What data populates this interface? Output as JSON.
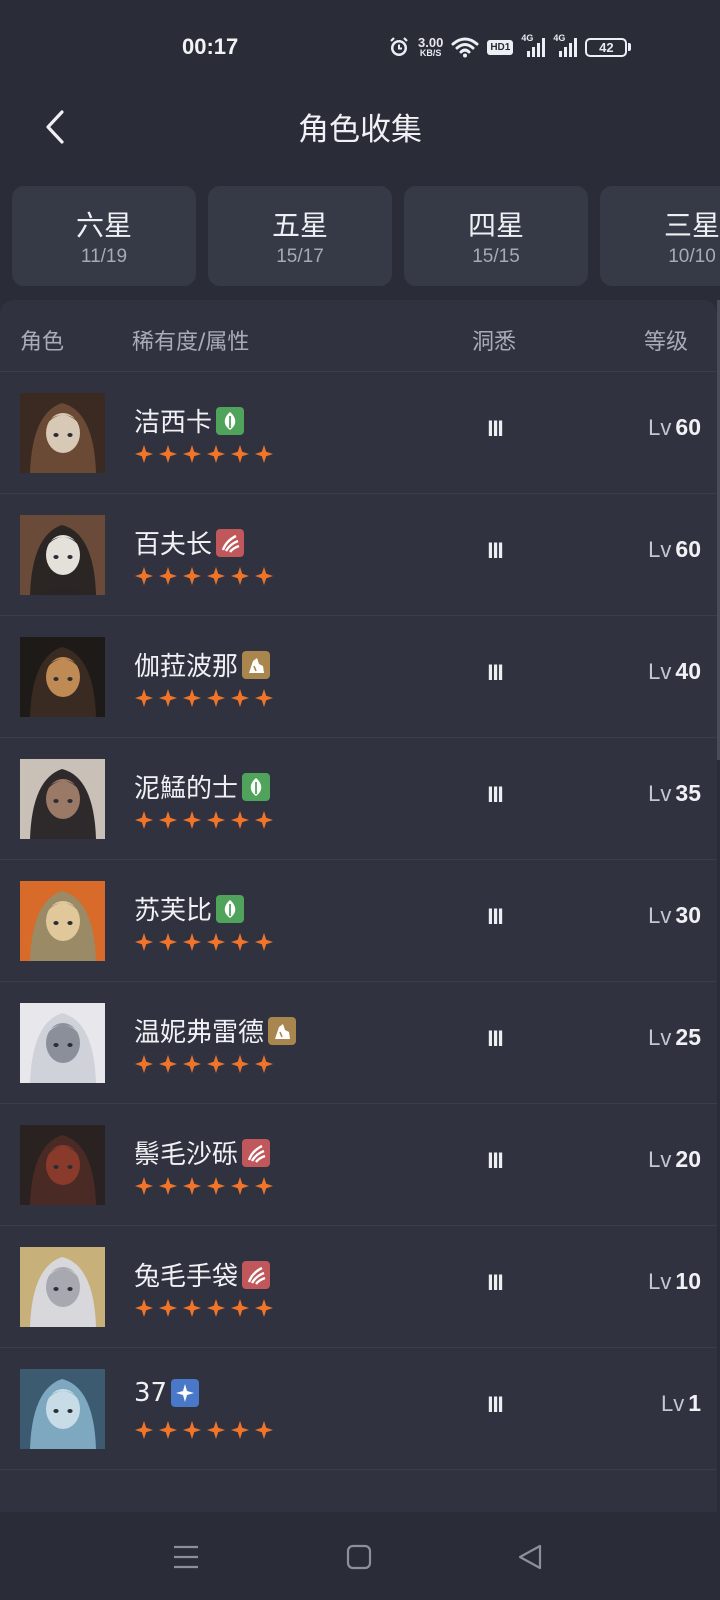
{
  "status_bar": {
    "time": "00:17",
    "net_speed_value": "3.00",
    "net_speed_unit": "KB/S",
    "hd_label": "HD1",
    "signal1_label": "4G",
    "signal2_label": "4G",
    "battery": "42"
  },
  "header": {
    "title": "角色收集"
  },
  "tabs": [
    {
      "label": "六星",
      "count": "11/19"
    },
    {
      "label": "五星",
      "count": "15/17"
    },
    {
      "label": "四星",
      "count": "15/15"
    },
    {
      "label": "三星",
      "count": "10/10"
    }
  ],
  "table": {
    "columns": {
      "role": "角色",
      "rarity": "稀有度/属性",
      "insight": "洞悉",
      "level": "等级"
    },
    "level_prefix": "Lv",
    "rows": [
      {
        "name": "洁西卡",
        "attribute": "plant",
        "insight": "III",
        "level": "60"
      },
      {
        "name": "百夫长",
        "attribute": "beast",
        "insight": "III",
        "level": "60"
      },
      {
        "name": "伽菈波那",
        "attribute": "mineral",
        "insight": "III",
        "level": "40"
      },
      {
        "name": "泥鯭的士",
        "attribute": "plant",
        "insight": "III",
        "level": "35"
      },
      {
        "name": "苏芙比",
        "attribute": "plant",
        "insight": "III",
        "level": "30"
      },
      {
        "name": "温妮弗雷德",
        "attribute": "mineral",
        "insight": "III",
        "level": "25"
      },
      {
        "name": "鬃毛沙砾",
        "attribute": "beast",
        "insight": "III",
        "level": "20"
      },
      {
        "name": "兔毛手袋",
        "attribute": "beast",
        "insight": "III",
        "level": "10"
      },
      {
        "name": "37",
        "attribute": "star",
        "insight": "III",
        "level": "1"
      }
    ]
  },
  "colors": {
    "background": "#2a2d38",
    "panel": "#30333f",
    "star": "#f0742a",
    "plant": "#4fa35a",
    "beast": "#c0575a",
    "mineral": "#a9864e",
    "star_attr": "#4a78c8"
  },
  "icons": {
    "back": "chevron-left-icon",
    "plant": "leaf-icon",
    "beast": "claw-icon",
    "mineral": "rock-icon",
    "star": "four-point-star-icon",
    "nav_menu": "menu-icon",
    "nav_home": "square-icon",
    "nav_back": "triangle-back-icon"
  }
}
